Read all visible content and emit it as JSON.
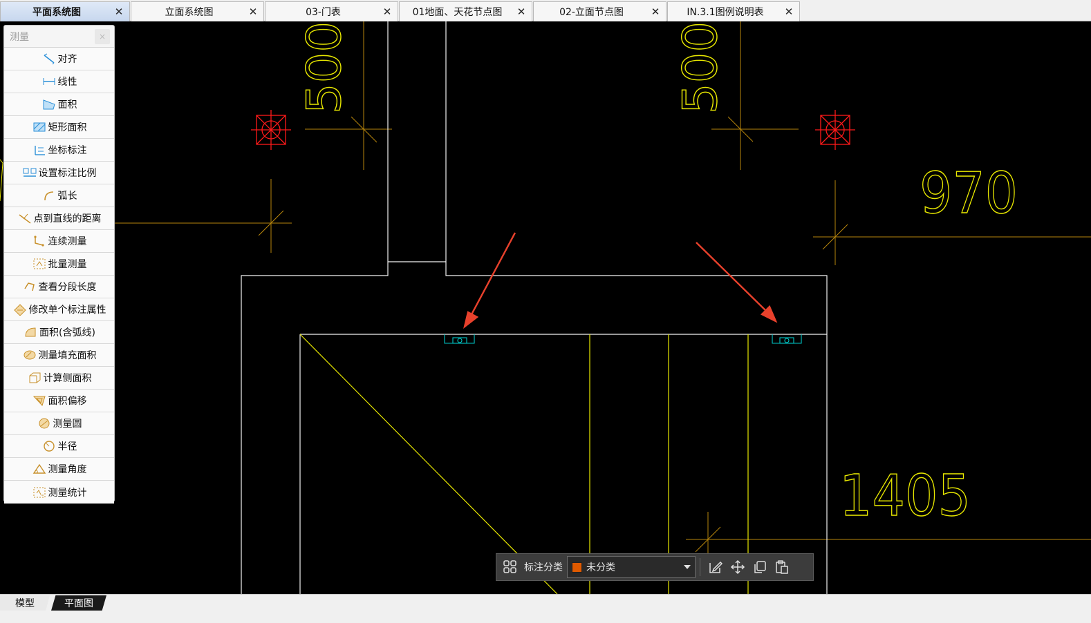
{
  "tabs": [
    {
      "label": "平面系统图",
      "active": true
    },
    {
      "label": "立面系统图",
      "active": false
    },
    {
      "label": "03-门表",
      "active": false
    },
    {
      "label": "01地面、天花节点图",
      "active": false
    },
    {
      "label": "02-立面节点图",
      "active": false
    },
    {
      "label": "IN.3.1图例说明表",
      "active": false
    }
  ],
  "tab_close_glyph": "✕",
  "panel": {
    "title": "测量",
    "close_glyph": "×",
    "items": [
      {
        "label": "对齐",
        "icon": "align-dimension-icon"
      },
      {
        "label": "线性",
        "icon": "linear-dimension-icon"
      },
      {
        "label": "面积",
        "icon": "area-icon"
      },
      {
        "label": "矩形面积",
        "icon": "rect-area-icon"
      },
      {
        "label": "坐标标注",
        "icon": "coordinate-icon"
      },
      {
        "label": "设置标注比例",
        "icon": "scale-icon"
      },
      {
        "label": "弧长",
        "icon": "arc-length-icon"
      },
      {
        "label": "点到直线的距离",
        "icon": "point-line-distance-icon"
      },
      {
        "label": "连续测量",
        "icon": "continuous-measure-icon"
      },
      {
        "label": "批量测量",
        "icon": "batch-measure-icon"
      },
      {
        "label": "查看分段长度",
        "icon": "segment-length-icon"
      },
      {
        "label": "修改单个标注属性",
        "icon": "edit-dimension-icon"
      },
      {
        "label": "面积(含弧线)",
        "icon": "arc-area-icon"
      },
      {
        "label": "测量填充面积",
        "icon": "hatch-area-icon"
      },
      {
        "label": "计算侧面积",
        "icon": "side-area-icon"
      },
      {
        "label": "面积偏移",
        "icon": "area-offset-icon"
      },
      {
        "label": "测量圆",
        "icon": "circle-measure-icon"
      },
      {
        "label": "半径",
        "icon": "radius-icon"
      },
      {
        "label": "测量角度",
        "icon": "angle-icon"
      },
      {
        "label": "测量统计",
        "icon": "statistics-icon"
      }
    ]
  },
  "drawing": {
    "texts": {
      "dim_500_left": "500",
      "dim_500_right": "500",
      "dim_970": "970",
      "dim_1405": "1405"
    },
    "colors": {
      "wall": "#ffffff",
      "door": "#e8e800",
      "dim_line": "#b8860b",
      "column": "#ff1a1a",
      "fixture": "#00c8c8",
      "arrow": "#e8412c"
    }
  },
  "float_toolbar": {
    "grid_icon": "layout-grid-icon",
    "label": "标注分类",
    "select_value": "未分类",
    "swatch_color": "#e05a00",
    "tools": [
      "edit-icon",
      "move-icon",
      "copy-icon",
      "paste-icon"
    ]
  },
  "bottom_tabs": [
    {
      "label": "模型",
      "active": false
    },
    {
      "label": "平面图",
      "active": true
    }
  ]
}
